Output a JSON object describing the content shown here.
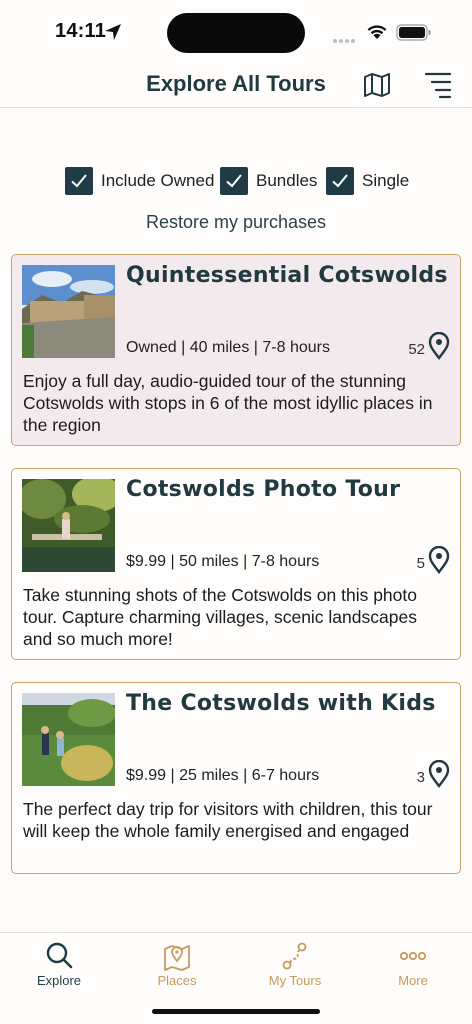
{
  "status": {
    "time": "14:11"
  },
  "header": {
    "title": "Explore All Tours"
  },
  "filters": [
    {
      "label": "Include Owned",
      "checked": true
    },
    {
      "label": "Bundles",
      "checked": true
    },
    {
      "label": "Single",
      "checked": true
    }
  ],
  "restore_label": "Restore my purchases",
  "tours": [
    {
      "title": "Quintessential Cotswolds",
      "meta": "Owned | 40 miles | 7-8 hours",
      "stops": "52",
      "description": "Enjoy a full day, audio-guided tour of the stunning Cotswolds with stops in 6 of the most idyllic places in the region"
    },
    {
      "title": "Cotswolds Photo Tour",
      "meta": "$9.99 | 50 miles | 7-8 hours",
      "stops": "5",
      "description": "Take stunning shots of the Cotswolds on this photo tour. Capture charming villages, scenic landscapes and so much more!"
    },
    {
      "title": "The Cotswolds with Kids",
      "meta": "$9.99 | 25 miles | 6-7 hours",
      "stops": "3",
      "description": "The perfect day trip for visitors with children, this tour will keep the whole family energised and engaged"
    }
  ],
  "tabs": [
    {
      "label": "Explore",
      "icon": "search-icon"
    },
    {
      "label": "Places",
      "icon": "map-pin-icon"
    },
    {
      "label": "My Tours",
      "icon": "route-icon"
    },
    {
      "label": "More",
      "icon": "more-icon"
    }
  ],
  "colors": {
    "primary": "#1f3b45",
    "accent": "#c59b5d",
    "owned_bg": "#f3eaed"
  }
}
